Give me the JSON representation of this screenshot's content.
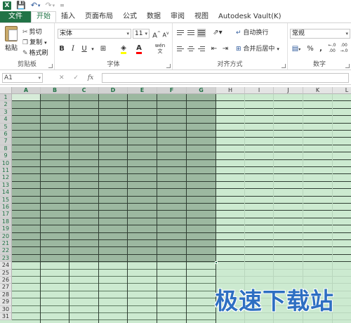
{
  "app": {
    "logo_letter": "X",
    "quick_access": [
      "save-icon",
      "undo-icon",
      "redo-icon",
      "customize-icon"
    ]
  },
  "tabs": [
    {
      "label": "文件"
    },
    {
      "label": "开始"
    },
    {
      "label": "插入"
    },
    {
      "label": "页面布局"
    },
    {
      "label": "公式"
    },
    {
      "label": "数据"
    },
    {
      "label": "审阅"
    },
    {
      "label": "视图"
    },
    {
      "label": "Autodesk Vault(K)"
    }
  ],
  "ribbon": {
    "clipboard": {
      "paste": "粘贴",
      "cut": "剪切",
      "copy": "复制",
      "format_painter": "格式刷",
      "group_label": "剪贴板"
    },
    "font": {
      "family": "宋体",
      "size": "11",
      "grow": "A",
      "shrink": "A",
      "bold": "B",
      "italic": "I",
      "underline": "U",
      "group_label": "字体",
      "wen": "wén"
    },
    "alignment": {
      "wrap_text": "自动换行",
      "merge_center": "合并后居中",
      "group_label": "对齐方式"
    },
    "number": {
      "format": "常规",
      "percent": "%",
      "comma": ",",
      "group_label": "数字"
    }
  },
  "formula_bar": {
    "name_box": "A1",
    "cancel": "✕",
    "enter": "✓",
    "fx": "fx",
    "value": ""
  },
  "sheet": {
    "columns": [
      "A",
      "B",
      "C",
      "D",
      "E",
      "F",
      "G",
      "H",
      "I",
      "J",
      "K",
      "L"
    ],
    "rows": [
      "1",
      "2",
      "3",
      "4",
      "5",
      "6",
      "7",
      "8",
      "9",
      "10",
      "11",
      "12",
      "13",
      "14",
      "15",
      "16",
      "17",
      "18",
      "19",
      "20",
      "21",
      "22",
      "23",
      "24",
      "25",
      "26",
      "27",
      "28",
      "29",
      "30",
      "31"
    ],
    "selection": "A1:G23"
  },
  "watermark": "极速下载站",
  "colors": {
    "brand": "#217346",
    "selection": "#9cb8a0",
    "sheet_bg": "#ccead0",
    "watermark": "#2e6fc2"
  }
}
